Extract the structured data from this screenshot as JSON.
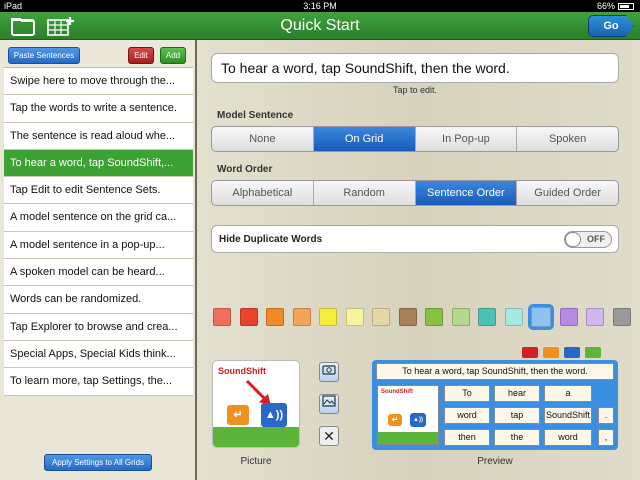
{
  "status": {
    "carrier": "iPad",
    "time": "3:16 PM",
    "battery": "66%"
  },
  "nav": {
    "title": "Quick Start",
    "go_label": "Go",
    "folder_icon": "folder-icon",
    "grid_add_icon": "grid-add-icon"
  },
  "sidebar": {
    "paste_label": "Paste Sentences",
    "edit_label": "Edit",
    "add_label": "Add",
    "apply_label": "Apply Settings to All Grids",
    "items": [
      {
        "label": "Swipe here to move through the..."
      },
      {
        "label": "Tap the words to write a sentence."
      },
      {
        "label": "The sentence is read aloud whe..."
      },
      {
        "label": "To hear a word, tap SoundShift,..."
      },
      {
        "label": "Tap Edit to edit Sentence Sets."
      },
      {
        "label": "A model sentence on the grid ca..."
      },
      {
        "label": "A model sentence in a pop-up..."
      },
      {
        "label": "A spoken model can be heard..."
      },
      {
        "label": "Words can be randomized."
      },
      {
        "label": "Tap Explorer to browse and crea..."
      },
      {
        "label": "Special Apps, Special Kids think..."
      },
      {
        "label": "To learn more, tap Settings, the..."
      }
    ],
    "selected_index": 3
  },
  "main": {
    "sentence": "To hear a word, tap SoundShift, then the word.",
    "tap_to_edit": "Tap to edit.",
    "model_sentence": {
      "label": "Model Sentence",
      "options": [
        "None",
        "On Grid",
        "In Pop-up",
        "Spoken"
      ],
      "selected": "On Grid"
    },
    "word_order": {
      "label": "Word Order",
      "options": [
        "Alphabetical",
        "Random",
        "Sentence Order",
        "Guided Order"
      ],
      "selected": "Sentence Order"
    },
    "hide_duplicates": {
      "label": "Hide Duplicate Words",
      "state": "OFF"
    },
    "colors": [
      "#ef6e5c",
      "#e8452e",
      "#f08a2b",
      "#f4a35a",
      "#f4ee3a",
      "#f7f3a0",
      "#e4d7a4",
      "#a7805a",
      "#86c240",
      "#b3d98c",
      "#4fc1b4",
      "#a8e6e2",
      "#8cc3f1",
      "#b58be6",
      "#d4b6ef",
      "#9a9a9a"
    ],
    "selected_color_index": 12,
    "picture": {
      "label": "Picture",
      "logo": "SoundShift"
    },
    "preview": {
      "label": "Preview",
      "sentence": "To hear a word, tap SoundShift, then the word.",
      "logo": "SoundShift",
      "words": [
        "To",
        "hear",
        "a",
        "word",
        "tap",
        "SoundShift",
        "then",
        "the",
        "word"
      ],
      "punct": [
        ".",
        ","
      ]
    }
  }
}
